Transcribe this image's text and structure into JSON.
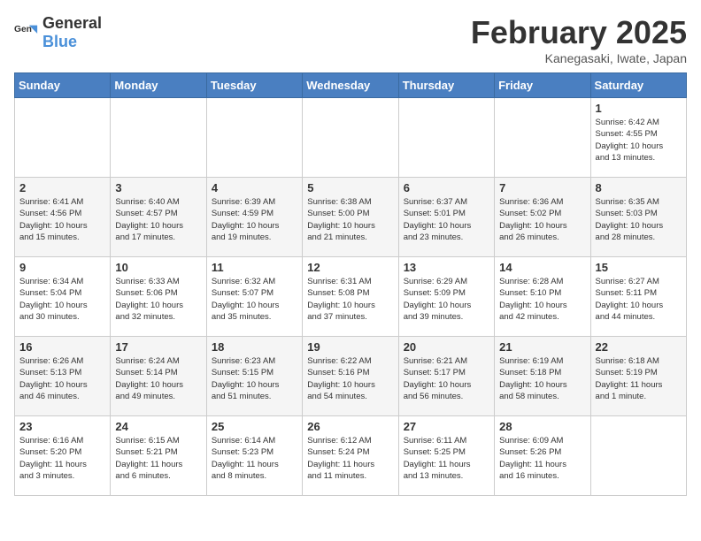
{
  "header": {
    "logo_general": "General",
    "logo_blue": "Blue",
    "title": "February 2025",
    "subtitle": "Kanegasaki, Iwate, Japan"
  },
  "days_of_week": [
    "Sunday",
    "Monday",
    "Tuesday",
    "Wednesday",
    "Thursday",
    "Friday",
    "Saturday"
  ],
  "weeks": [
    [
      {
        "day": "",
        "info": ""
      },
      {
        "day": "",
        "info": ""
      },
      {
        "day": "",
        "info": ""
      },
      {
        "day": "",
        "info": ""
      },
      {
        "day": "",
        "info": ""
      },
      {
        "day": "",
        "info": ""
      },
      {
        "day": "1",
        "info": "Sunrise: 6:42 AM\nSunset: 4:55 PM\nDaylight: 10 hours\nand 13 minutes."
      }
    ],
    [
      {
        "day": "2",
        "info": "Sunrise: 6:41 AM\nSunset: 4:56 PM\nDaylight: 10 hours\nand 15 minutes."
      },
      {
        "day": "3",
        "info": "Sunrise: 6:40 AM\nSunset: 4:57 PM\nDaylight: 10 hours\nand 17 minutes."
      },
      {
        "day": "4",
        "info": "Sunrise: 6:39 AM\nSunset: 4:59 PM\nDaylight: 10 hours\nand 19 minutes."
      },
      {
        "day": "5",
        "info": "Sunrise: 6:38 AM\nSunset: 5:00 PM\nDaylight: 10 hours\nand 21 minutes."
      },
      {
        "day": "6",
        "info": "Sunrise: 6:37 AM\nSunset: 5:01 PM\nDaylight: 10 hours\nand 23 minutes."
      },
      {
        "day": "7",
        "info": "Sunrise: 6:36 AM\nSunset: 5:02 PM\nDaylight: 10 hours\nand 26 minutes."
      },
      {
        "day": "8",
        "info": "Sunrise: 6:35 AM\nSunset: 5:03 PM\nDaylight: 10 hours\nand 28 minutes."
      }
    ],
    [
      {
        "day": "9",
        "info": "Sunrise: 6:34 AM\nSunset: 5:04 PM\nDaylight: 10 hours\nand 30 minutes."
      },
      {
        "day": "10",
        "info": "Sunrise: 6:33 AM\nSunset: 5:06 PM\nDaylight: 10 hours\nand 32 minutes."
      },
      {
        "day": "11",
        "info": "Sunrise: 6:32 AM\nSunset: 5:07 PM\nDaylight: 10 hours\nand 35 minutes."
      },
      {
        "day": "12",
        "info": "Sunrise: 6:31 AM\nSunset: 5:08 PM\nDaylight: 10 hours\nand 37 minutes."
      },
      {
        "day": "13",
        "info": "Sunrise: 6:29 AM\nSunset: 5:09 PM\nDaylight: 10 hours\nand 39 minutes."
      },
      {
        "day": "14",
        "info": "Sunrise: 6:28 AM\nSunset: 5:10 PM\nDaylight: 10 hours\nand 42 minutes."
      },
      {
        "day": "15",
        "info": "Sunrise: 6:27 AM\nSunset: 5:11 PM\nDaylight: 10 hours\nand 44 minutes."
      }
    ],
    [
      {
        "day": "16",
        "info": "Sunrise: 6:26 AM\nSunset: 5:13 PM\nDaylight: 10 hours\nand 46 minutes."
      },
      {
        "day": "17",
        "info": "Sunrise: 6:24 AM\nSunset: 5:14 PM\nDaylight: 10 hours\nand 49 minutes."
      },
      {
        "day": "18",
        "info": "Sunrise: 6:23 AM\nSunset: 5:15 PM\nDaylight: 10 hours\nand 51 minutes."
      },
      {
        "day": "19",
        "info": "Sunrise: 6:22 AM\nSunset: 5:16 PM\nDaylight: 10 hours\nand 54 minutes."
      },
      {
        "day": "20",
        "info": "Sunrise: 6:21 AM\nSunset: 5:17 PM\nDaylight: 10 hours\nand 56 minutes."
      },
      {
        "day": "21",
        "info": "Sunrise: 6:19 AM\nSunset: 5:18 PM\nDaylight: 10 hours\nand 58 minutes."
      },
      {
        "day": "22",
        "info": "Sunrise: 6:18 AM\nSunset: 5:19 PM\nDaylight: 11 hours\nand 1 minute."
      }
    ],
    [
      {
        "day": "23",
        "info": "Sunrise: 6:16 AM\nSunset: 5:20 PM\nDaylight: 11 hours\nand 3 minutes."
      },
      {
        "day": "24",
        "info": "Sunrise: 6:15 AM\nSunset: 5:21 PM\nDaylight: 11 hours\nand 6 minutes."
      },
      {
        "day": "25",
        "info": "Sunrise: 6:14 AM\nSunset: 5:23 PM\nDaylight: 11 hours\nand 8 minutes."
      },
      {
        "day": "26",
        "info": "Sunrise: 6:12 AM\nSunset: 5:24 PM\nDaylight: 11 hours\nand 11 minutes."
      },
      {
        "day": "27",
        "info": "Sunrise: 6:11 AM\nSunset: 5:25 PM\nDaylight: 11 hours\nand 13 minutes."
      },
      {
        "day": "28",
        "info": "Sunrise: 6:09 AM\nSunset: 5:26 PM\nDaylight: 11 hours\nand 16 minutes."
      },
      {
        "day": "",
        "info": ""
      }
    ]
  ]
}
